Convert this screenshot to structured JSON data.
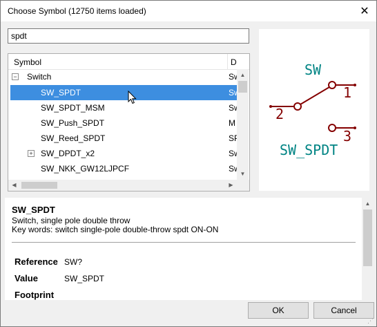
{
  "window": {
    "title": "Choose Symbol (12750 items loaded)",
    "close_glyph": "✕"
  },
  "search": {
    "value": "spdt"
  },
  "tree": {
    "columns": [
      "Symbol",
      "D"
    ],
    "rows": [
      {
        "label": "Switch",
        "desc": "Sw",
        "level": 0,
        "expander": "−",
        "selected": false
      },
      {
        "label": "SW_SPDT",
        "desc": "Sw",
        "level": 1,
        "expander": "",
        "selected": true
      },
      {
        "label": "SW_SPDT_MSM",
        "desc": "Sw",
        "level": 1,
        "expander": "",
        "selected": false
      },
      {
        "label": "SW_Push_SPDT",
        "desc": "M",
        "level": 1,
        "expander": "",
        "selected": false
      },
      {
        "label": "SW_Reed_SPDT",
        "desc": "SP",
        "level": 1,
        "expander": "",
        "selected": false
      },
      {
        "label": "SW_DPDT_x2",
        "desc": "Sw",
        "level": 1,
        "expander": "+",
        "selected": false
      },
      {
        "label": "SW_NKK_GW12LJPCF",
        "desc": "Sw",
        "level": 1,
        "expander": "",
        "selected": false
      }
    ]
  },
  "preview": {
    "reference": "SW",
    "value": "SW_SPDT",
    "pin_numbers": [
      "1",
      "2",
      "3"
    ],
    "colors": {
      "text": "#008484",
      "body": "#840000"
    }
  },
  "details": {
    "name": "SW_SPDT",
    "description": "Switch, single pole double throw",
    "keywords": "Key words: switch single-pole double-throw spdt ON-ON",
    "fields": [
      {
        "label": "Reference",
        "value": "SW?"
      },
      {
        "label": "Value",
        "value": "SW_SPDT"
      },
      {
        "label": "Footprint",
        "value": ""
      }
    ]
  },
  "buttons": {
    "ok": "OK",
    "cancel": "Cancel"
  },
  "colors": {
    "selection": "#3d8ee0"
  }
}
